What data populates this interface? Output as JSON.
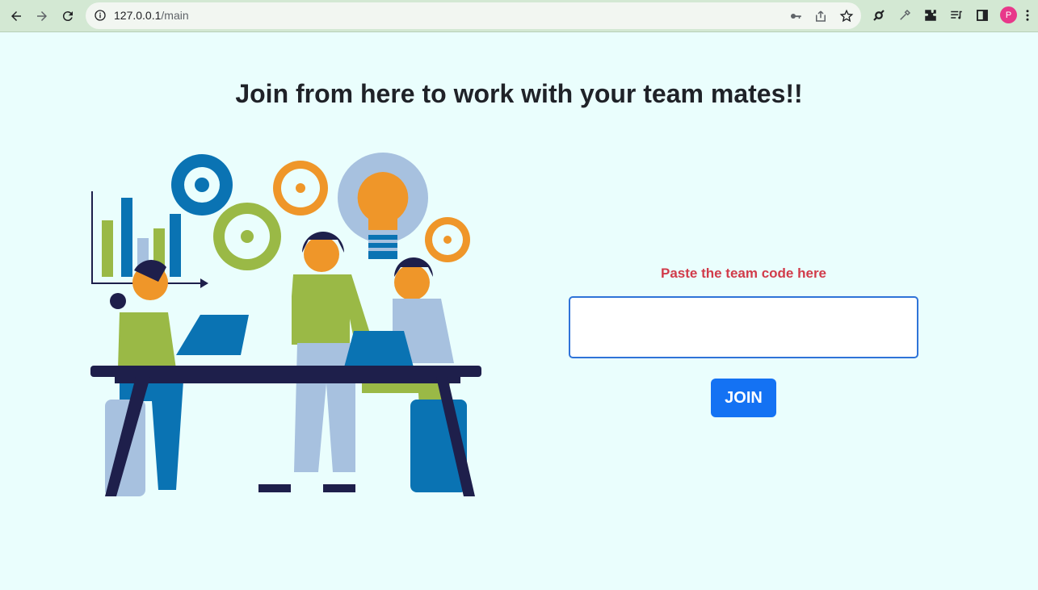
{
  "browser": {
    "url_host": "127.0.0.1",
    "url_path": "/main",
    "profile_initial": "P",
    "icons": [
      "back-icon",
      "forward-icon",
      "reload-icon",
      "site-info-icon",
      "key-icon",
      "share-icon",
      "star-icon",
      "extension-icon",
      "eyedropper-icon",
      "puzzle-icon",
      "media-icon",
      "sidebar-icon",
      "menu-icon"
    ]
  },
  "page": {
    "title": "Join from here to work with your team mates!!",
    "code_label": "Paste the team code here",
    "code_value": "",
    "join_label": "JOIN"
  },
  "colors": {
    "background": "#eafefd",
    "label": "#d13b4a",
    "button": "#1472f3",
    "input_border": "#2f73d8"
  }
}
